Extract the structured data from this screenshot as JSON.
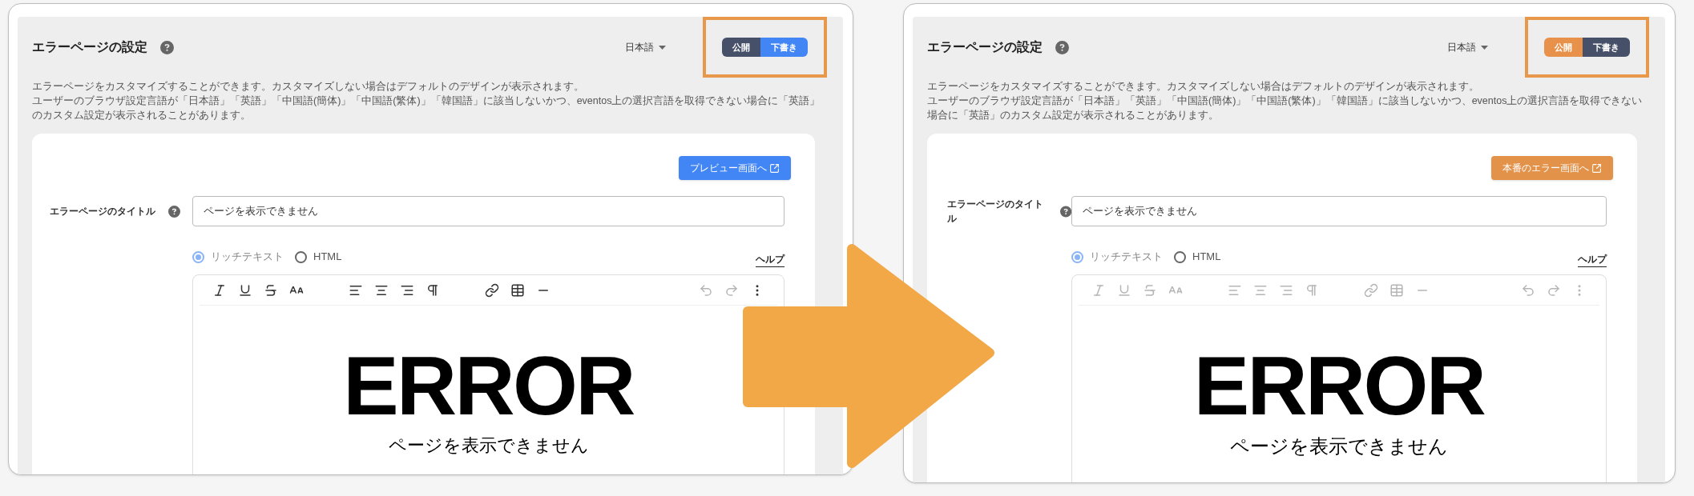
{
  "panels": [
    {
      "kind": "draft",
      "title": "エラーページの設定",
      "language": "日本語",
      "status_toggle": [
        {
          "label": "公開",
          "selected": false
        },
        {
          "label": "下書き",
          "selected": true
        }
      ],
      "description": [
        "エラーページをカスタマイズすることができます。カスタマイズしない場合はデフォルトのデザインが表示されます。",
        "ユーザーのブラウザ設定言語が「日本語」「英語」「中国語(簡体)」「中国語(繁体)」「韓国語」に該当しないかつ、eventos上の選択言語を取得できない場合に「英語」のカスタム設定が表示されることがあります。"
      ],
      "link_button": "プレビュー画面へ",
      "field_label": "エラーページのタイトル",
      "field_value": "ページを表示できません",
      "editor_modes": [
        {
          "label": "リッチテキスト",
          "selected": true
        },
        {
          "label": "HTML",
          "selected": false
        }
      ],
      "help_link": "ヘルプ",
      "toolbar_disabled": false,
      "preview_heading": "ERROR",
      "preview_text": "ページを表示できません"
    },
    {
      "kind": "published",
      "title": "エラーページの設定",
      "language": "日本語",
      "status_toggle": [
        {
          "label": "公開",
          "selected": true
        },
        {
          "label": "下書き",
          "selected": false
        }
      ],
      "description": [
        "エラーページをカスタマイズすることができます。カスタマイズしない場合はデフォルトのデザインが表示されます。",
        "ユーザーのブラウザ設定言語が「日本語」「英語」「中国語(簡体)」「中国語(繁体)」「韓国語」に該当しないかつ、eventos上の選択言語を取得できない場合に「英語」のカスタム設定が表示されることがあります。"
      ],
      "link_button": "本番のエラー画面へ",
      "field_label": "エラーページのタイトル",
      "field_value": "ページを表示できません",
      "editor_modes": [
        {
          "label": "リッチテキスト",
          "selected": true
        },
        {
          "label": "HTML",
          "selected": false
        }
      ],
      "help_link": "ヘルプ",
      "toolbar_disabled": true,
      "preview_heading": "ERROR",
      "preview_text": "ページを表示できません"
    }
  ]
}
